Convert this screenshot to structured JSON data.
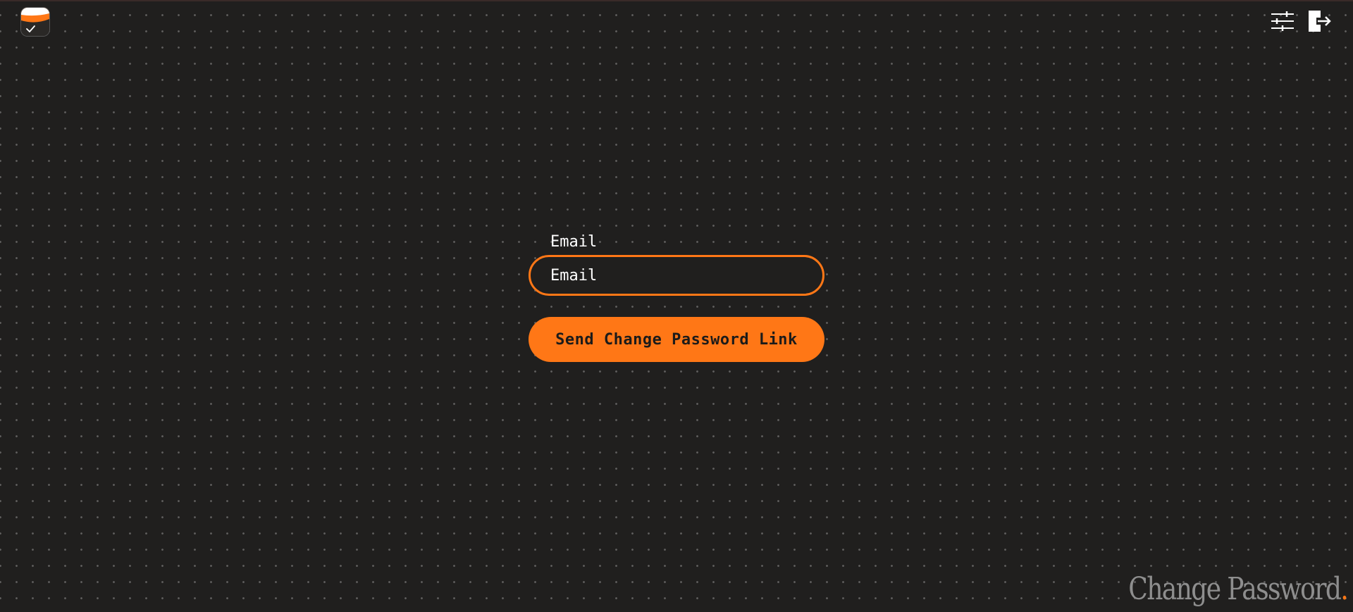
{
  "header": {
    "logo_icon": "task-logo-icon",
    "actions": [
      {
        "icon": "sliders-icon",
        "name": "settings"
      },
      {
        "icon": "logout-icon",
        "name": "logout"
      }
    ]
  },
  "form": {
    "email_label": "Email",
    "email_placeholder": "Email",
    "email_value": "",
    "submit_label": "Send Change Password Link"
  },
  "watermark": {
    "text": "Change Password",
    "dot": "."
  },
  "colors": {
    "background": "#201f1e",
    "accent": "#ff7716",
    "text": "#ffffff",
    "muted": "#8e8e8e"
  }
}
